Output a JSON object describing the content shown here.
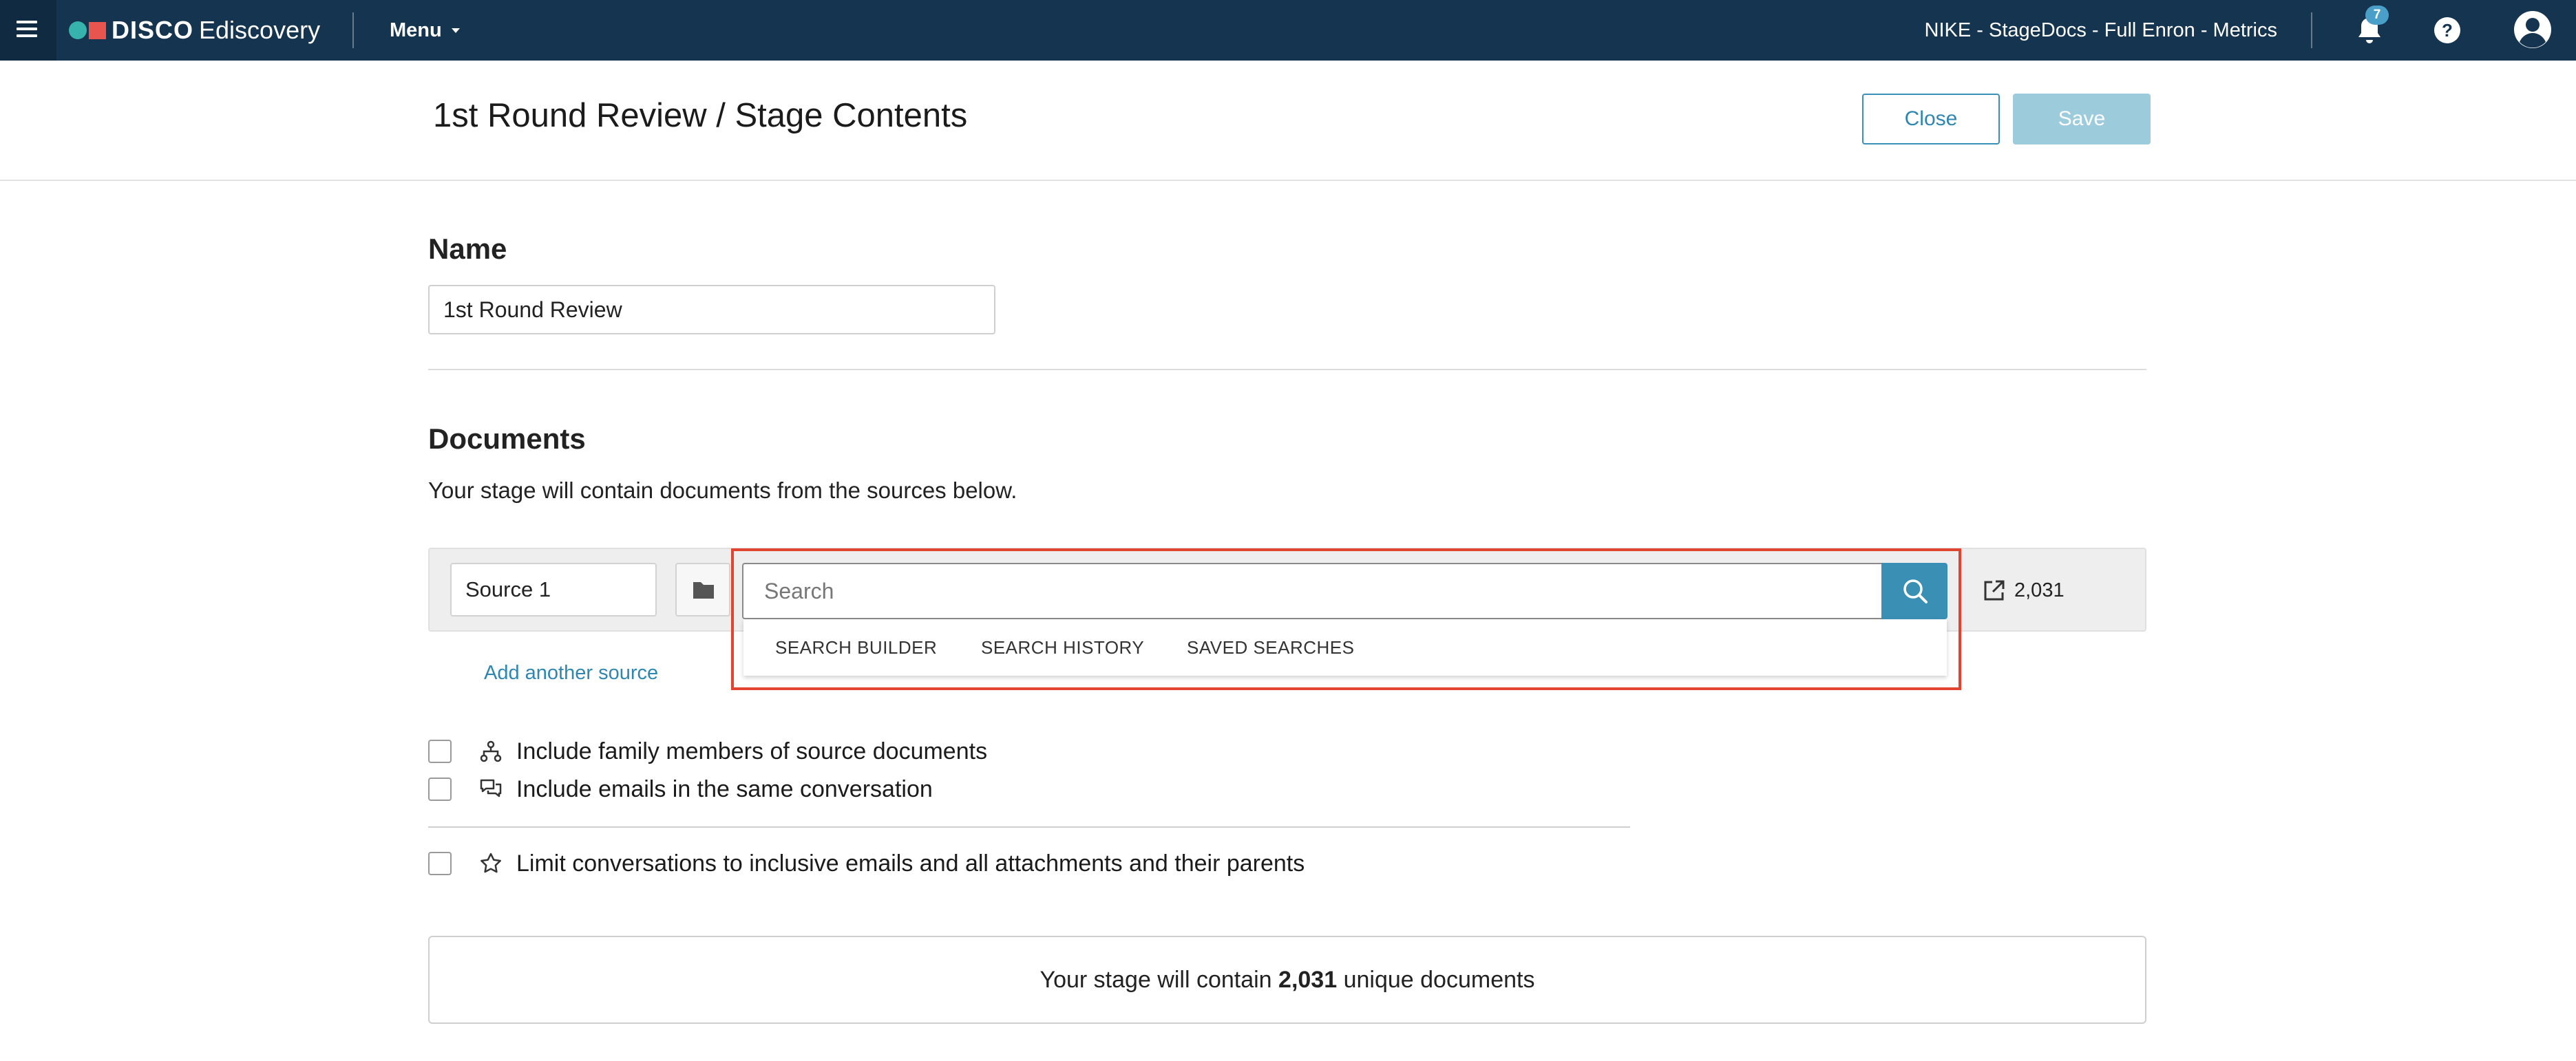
{
  "topbar": {
    "brand": "DISCO",
    "product": "Ediscovery",
    "menu_label": "Menu",
    "matter_title": "NIKE - StageDocs - Full Enron - Metrics",
    "notification_count": "7",
    "help_label": "?"
  },
  "header": {
    "title": "1st Round Review / Stage Contents",
    "close_label": "Close",
    "save_label": "Save"
  },
  "name_section": {
    "label": "Name",
    "value": "1st Round Review"
  },
  "documents": {
    "label": "Documents",
    "description": "Your stage will contain documents from the sources below.",
    "source": {
      "name": "Source 1",
      "search_placeholder": "Search",
      "menu": [
        "SEARCH BUILDER",
        "SEARCH HISTORY",
        "SAVED SEARCHES"
      ],
      "count": "2,031"
    },
    "add_source_label": "Add another source"
  },
  "options": [
    {
      "label": "Include family members of source documents",
      "icon": "family-tree-icon"
    },
    {
      "label": "Include emails in the same conversation",
      "icon": "conversation-icon"
    },
    {
      "label": "Limit conversations to inclusive emails and all attachments and their parents",
      "icon": "star-icon"
    }
  ],
  "summary": {
    "prefix": "Your stage will contain",
    "count": "2,031",
    "suffix": "unique documents"
  },
  "colors": {
    "topbar": "#14344f",
    "accent": "#3a8fb5",
    "save_disabled": "#9ccbdb",
    "highlight": "#e2452f",
    "logo_teal": "#37b3ad",
    "logo_red": "#e8544e"
  }
}
